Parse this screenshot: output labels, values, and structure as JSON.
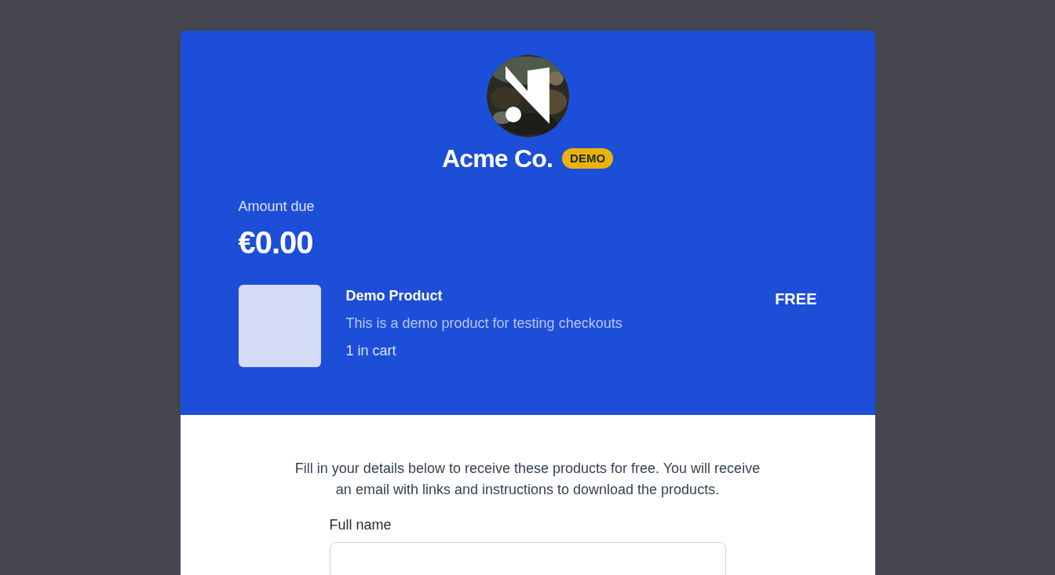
{
  "brand": {
    "name": "Acme Co.",
    "badge": "DEMO"
  },
  "amount": {
    "label": "Amount due",
    "value": "€0.00"
  },
  "items": [
    {
      "name": "Demo Product",
      "description": "This is a demo product for testing checkouts",
      "quantity": "1 in cart",
      "price": "FREE"
    }
  ],
  "form": {
    "intro": "Fill in your details below to receive these products for free. You will receive an email with links and instructions to download the products.",
    "fields": [
      {
        "label": "Full name"
      }
    ]
  }
}
